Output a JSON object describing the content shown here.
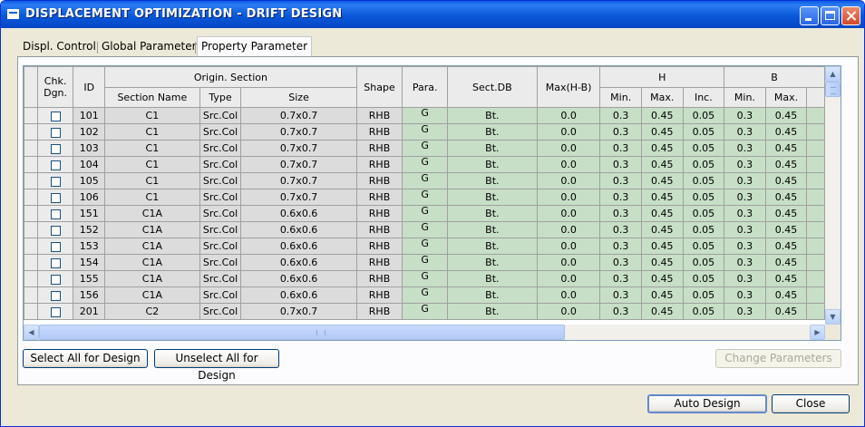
{
  "window": {
    "title": "DISPLACEMENT OPTIMIZATION - DRIFT DESIGN"
  },
  "tabs": [
    {
      "label": "Displ. Control"
    },
    {
      "label": "Global Parameter"
    },
    {
      "label": "Property Parameter"
    }
  ],
  "active_tab": "Property Parameter",
  "grid": {
    "headers": {
      "chk_dgn_line1": "Chk.",
      "chk_dgn_line2": "Dgn.",
      "id": "ID",
      "origin_section": "Origin. Section",
      "section_name": "Section Name",
      "type": "Type",
      "size": "Size",
      "shape": "Shape",
      "para": "Para.",
      "sect_db": "Sect.DB",
      "max_hb": "Max(H-B)",
      "h": "H",
      "b": "B",
      "min": "Min.",
      "max": "Max.",
      "inc": "Inc."
    },
    "rows": [
      {
        "id": "101",
        "name": "C1",
        "type": "Src.Col",
        "size": "0.7x0.7",
        "shape": "RHB",
        "para": "G",
        "sectdb": "Bt.",
        "maxhb": "0.0",
        "hmin": "0.3",
        "hmax": "0.45",
        "hinc": "0.05",
        "bmin": "0.3",
        "bmax": "0.45"
      },
      {
        "id": "102",
        "name": "C1",
        "type": "Src.Col",
        "size": "0.7x0.7",
        "shape": "RHB",
        "para": "G",
        "sectdb": "Bt.",
        "maxhb": "0.0",
        "hmin": "0.3",
        "hmax": "0.45",
        "hinc": "0.05",
        "bmin": "0.3",
        "bmax": "0.45"
      },
      {
        "id": "103",
        "name": "C1",
        "type": "Src.Col",
        "size": "0.7x0.7",
        "shape": "RHB",
        "para": "G",
        "sectdb": "Bt.",
        "maxhb": "0.0",
        "hmin": "0.3",
        "hmax": "0.45",
        "hinc": "0.05",
        "bmin": "0.3",
        "bmax": "0.45"
      },
      {
        "id": "104",
        "name": "C1",
        "type": "Src.Col",
        "size": "0.7x0.7",
        "shape": "RHB",
        "para": "G",
        "sectdb": "Bt.",
        "maxhb": "0.0",
        "hmin": "0.3",
        "hmax": "0.45",
        "hinc": "0.05",
        "bmin": "0.3",
        "bmax": "0.45"
      },
      {
        "id": "105",
        "name": "C1",
        "type": "Src.Col",
        "size": "0.7x0.7",
        "shape": "RHB",
        "para": "G",
        "sectdb": "Bt.",
        "maxhb": "0.0",
        "hmin": "0.3",
        "hmax": "0.45",
        "hinc": "0.05",
        "bmin": "0.3",
        "bmax": "0.45"
      },
      {
        "id": "106",
        "name": "C1",
        "type": "Src.Col",
        "size": "0.7x0.7",
        "shape": "RHB",
        "para": "G",
        "sectdb": "Bt.",
        "maxhb": "0.0",
        "hmin": "0.3",
        "hmax": "0.45",
        "hinc": "0.05",
        "bmin": "0.3",
        "bmax": "0.45"
      },
      {
        "id": "151",
        "name": "C1A",
        "type": "Src.Col",
        "size": "0.6x0.6",
        "shape": "RHB",
        "para": "G",
        "sectdb": "Bt.",
        "maxhb": "0.0",
        "hmin": "0.3",
        "hmax": "0.45",
        "hinc": "0.05",
        "bmin": "0.3",
        "bmax": "0.45"
      },
      {
        "id": "152",
        "name": "C1A",
        "type": "Src.Col",
        "size": "0.6x0.6",
        "shape": "RHB",
        "para": "G",
        "sectdb": "Bt.",
        "maxhb": "0.0",
        "hmin": "0.3",
        "hmax": "0.45",
        "hinc": "0.05",
        "bmin": "0.3",
        "bmax": "0.45"
      },
      {
        "id": "153",
        "name": "C1A",
        "type": "Src.Col",
        "size": "0.6x0.6",
        "shape": "RHB",
        "para": "G",
        "sectdb": "Bt.",
        "maxhb": "0.0",
        "hmin": "0.3",
        "hmax": "0.45",
        "hinc": "0.05",
        "bmin": "0.3",
        "bmax": "0.45"
      },
      {
        "id": "154",
        "name": "C1A",
        "type": "Src.Col",
        "size": "0.6x0.6",
        "shape": "RHB",
        "para": "G",
        "sectdb": "Bt.",
        "maxhb": "0.0",
        "hmin": "0.3",
        "hmax": "0.45",
        "hinc": "0.05",
        "bmin": "0.3",
        "bmax": "0.45"
      },
      {
        "id": "155",
        "name": "C1A",
        "type": "Src.Col",
        "size": "0.6x0.6",
        "shape": "RHB",
        "para": "G",
        "sectdb": "Bt.",
        "maxhb": "0.0",
        "hmin": "0.3",
        "hmax": "0.45",
        "hinc": "0.05",
        "bmin": "0.3",
        "bmax": "0.45"
      },
      {
        "id": "156",
        "name": "C1A",
        "type": "Src.Col",
        "size": "0.6x0.6",
        "shape": "RHB",
        "para": "G",
        "sectdb": "Bt.",
        "maxhb": "0.0",
        "hmin": "0.3",
        "hmax": "0.45",
        "hinc": "0.05",
        "bmin": "0.3",
        "bmax": "0.45"
      },
      {
        "id": "201",
        "name": "C2",
        "type": "Src.Col",
        "size": "0.7x0.7",
        "shape": "RHB",
        "para": "G",
        "sectdb": "Bt.",
        "maxhb": "0.0",
        "hmin": "0.3",
        "hmax": "0.45",
        "hinc": "0.05",
        "bmin": "0.3",
        "bmax": "0.45"
      }
    ]
  },
  "buttons": {
    "select_all": "Select All for Design",
    "unselect_all": "Unselect All for Design",
    "change_parameters": "Change Parameters",
    "auto_design": "Auto Design",
    "close": "Close"
  },
  "icons": {
    "scroll_up": "▲",
    "scroll_down": "▼",
    "scroll_left": "◀",
    "scroll_right": "▶"
  }
}
